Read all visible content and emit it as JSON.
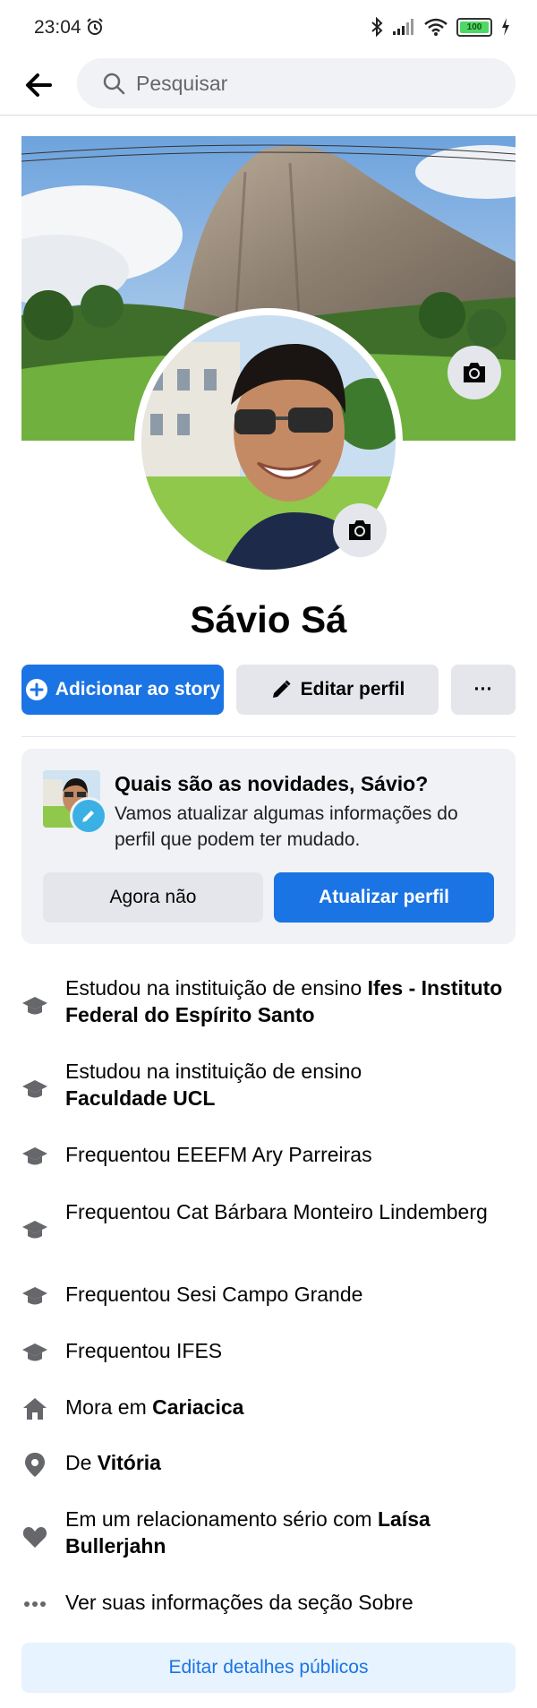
{
  "status_bar": {
    "time": "23:04",
    "battery": "100"
  },
  "search": {
    "placeholder": "Pesquisar"
  },
  "profile": {
    "name": "Sávio Sá"
  },
  "actions": {
    "add_story": "Adicionar ao story",
    "edit_profile": "Editar perfil",
    "more": "···"
  },
  "update_card": {
    "title": "Quais são as novidades, Sávio?",
    "text": "Vamos atualizar algumas informações do perfil que podem ter mudado.",
    "dismiss": "Agora não",
    "update": "Atualizar perfil"
  },
  "details": [
    {
      "icon": "graduation-cap-icon",
      "prefix": "Estudou na instituição de ensino ",
      "bold": "Ifes - Instituto Federal do Espírito Santo"
    },
    {
      "icon": "graduation-cap-icon",
      "prefix": "Estudou na instituição de ensino ",
      "bold": "Faculdade UCL"
    },
    {
      "icon": "graduation-cap-icon",
      "prefix": "Frequentou EEEFM Ary Parreiras",
      "bold": ""
    },
    {
      "icon": "graduation-cap-icon",
      "prefix": "Frequentou Cat Bárbara Monteiro Lindemberg",
      "bold": ""
    },
    {
      "icon": "graduation-cap-icon",
      "prefix": "Frequentou Sesi Campo Grande",
      "bold": ""
    },
    {
      "icon": "graduation-cap-icon",
      "prefix": "Frequentou IFES",
      "bold": ""
    },
    {
      "icon": "home-icon",
      "prefix": "Mora em ",
      "bold": "Cariacica"
    },
    {
      "icon": "location-pin-icon",
      "prefix": "De ",
      "bold": "Vitória"
    },
    {
      "icon": "heart-icon",
      "prefix": "Em um relacionamento sério com ",
      "bold": "Laísa Bullerjahn"
    },
    {
      "icon": "more-horizontal-icon",
      "prefix": "Ver suas informações da seção Sobre",
      "bold": ""
    }
  ],
  "edit_public_details": "Editar detalhes públicos",
  "colors": {
    "primary": "#1b74e4",
    "secondary_bg": "#e4e6eb",
    "card_bg": "#f0f2f5",
    "icon_gray": "#65676b"
  }
}
